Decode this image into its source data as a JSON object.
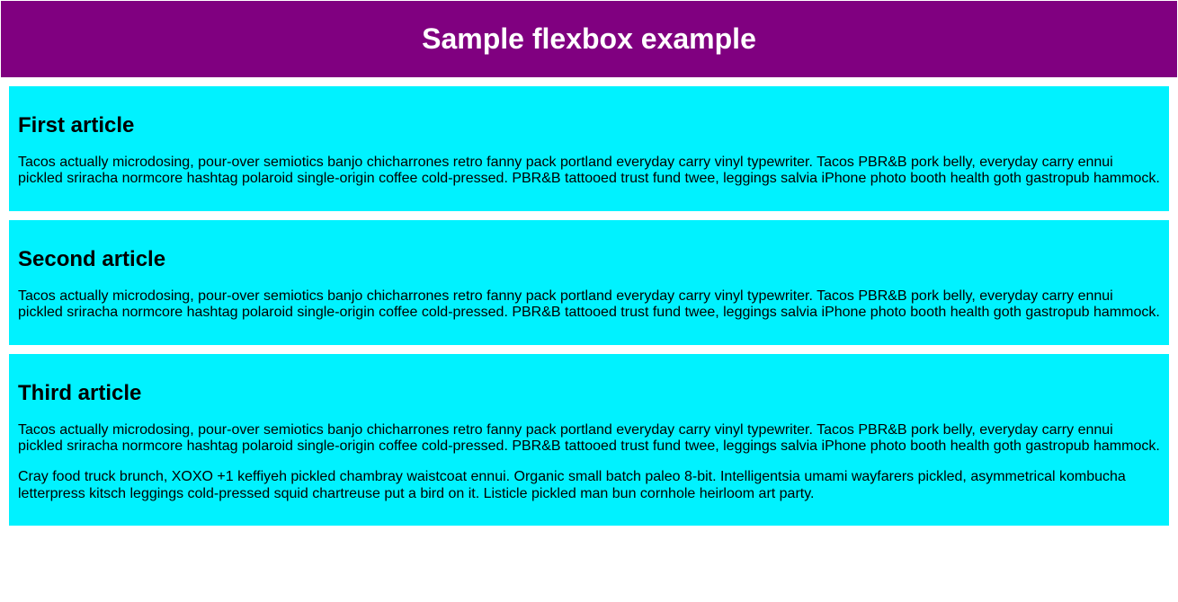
{
  "header": {
    "title": "Sample flexbox example"
  },
  "articles": [
    {
      "title": "First article",
      "paragraphs": [
        "Tacos actually microdosing, pour-over semiotics banjo chicharrones retro fanny pack portland everyday carry vinyl typewriter. Tacos PBR&B pork belly, everyday carry ennui pickled sriracha normcore hashtag polaroid single-origin coffee cold-pressed. PBR&B tattooed trust fund twee, leggings salvia iPhone photo booth health goth gastropub hammock."
      ]
    },
    {
      "title": "Second article",
      "paragraphs": [
        "Tacos actually microdosing, pour-over semiotics banjo chicharrones retro fanny pack portland everyday carry vinyl typewriter. Tacos PBR&B pork belly, everyday carry ennui pickled sriracha normcore hashtag polaroid single-origin coffee cold-pressed. PBR&B tattooed trust fund twee, leggings salvia iPhone photo booth health goth gastropub hammock."
      ]
    },
    {
      "title": "Third article",
      "paragraphs": [
        "Tacos actually microdosing, pour-over semiotics banjo chicharrones retro fanny pack portland everyday carry vinyl typewriter. Tacos PBR&B pork belly, everyday carry ennui pickled sriracha normcore hashtag polaroid single-origin coffee cold-pressed. PBR&B tattooed trust fund twee, leggings salvia iPhone photo booth health goth gastropub hammock.",
        "Cray food truck brunch, XOXO +1 keffiyeh pickled chambray waistcoat ennui. Organic small batch paleo 8-bit. Intelligentsia umami wayfarers pickled, asymmetrical kombucha letterpress kitsch leggings cold-pressed squid chartreuse put a bird on it. Listicle pickled man bun cornhole heirloom art party."
      ]
    }
  ]
}
